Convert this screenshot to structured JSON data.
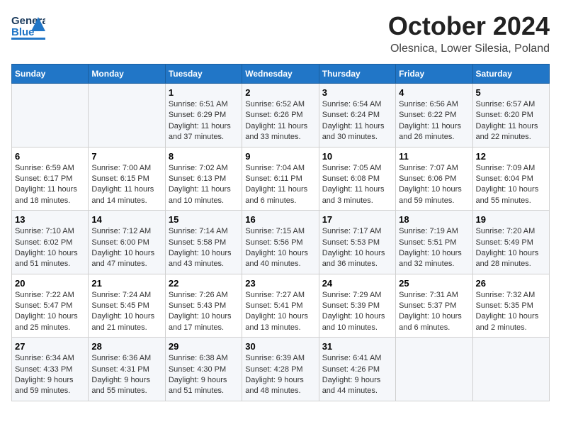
{
  "header": {
    "logo_general": "General",
    "logo_blue": "Blue",
    "month": "October 2024",
    "location": "Olesnica, Lower Silesia, Poland"
  },
  "days_of_week": [
    "Sunday",
    "Monday",
    "Tuesday",
    "Wednesday",
    "Thursday",
    "Friday",
    "Saturday"
  ],
  "weeks": [
    [
      {
        "day": "",
        "content": ""
      },
      {
        "day": "",
        "content": ""
      },
      {
        "day": "1",
        "content": "Sunrise: 6:51 AM\nSunset: 6:29 PM\nDaylight: 11 hours and 37 minutes."
      },
      {
        "day": "2",
        "content": "Sunrise: 6:52 AM\nSunset: 6:26 PM\nDaylight: 11 hours and 33 minutes."
      },
      {
        "day": "3",
        "content": "Sunrise: 6:54 AM\nSunset: 6:24 PM\nDaylight: 11 hours and 30 minutes."
      },
      {
        "day": "4",
        "content": "Sunrise: 6:56 AM\nSunset: 6:22 PM\nDaylight: 11 hours and 26 minutes."
      },
      {
        "day": "5",
        "content": "Sunrise: 6:57 AM\nSunset: 6:20 PM\nDaylight: 11 hours and 22 minutes."
      }
    ],
    [
      {
        "day": "6",
        "content": "Sunrise: 6:59 AM\nSunset: 6:17 PM\nDaylight: 11 hours and 18 minutes."
      },
      {
        "day": "7",
        "content": "Sunrise: 7:00 AM\nSunset: 6:15 PM\nDaylight: 11 hours and 14 minutes."
      },
      {
        "day": "8",
        "content": "Sunrise: 7:02 AM\nSunset: 6:13 PM\nDaylight: 11 hours and 10 minutes."
      },
      {
        "day": "9",
        "content": "Sunrise: 7:04 AM\nSunset: 6:11 PM\nDaylight: 11 hours and 6 minutes."
      },
      {
        "day": "10",
        "content": "Sunrise: 7:05 AM\nSunset: 6:08 PM\nDaylight: 11 hours and 3 minutes."
      },
      {
        "day": "11",
        "content": "Sunrise: 7:07 AM\nSunset: 6:06 PM\nDaylight: 10 hours and 59 minutes."
      },
      {
        "day": "12",
        "content": "Sunrise: 7:09 AM\nSunset: 6:04 PM\nDaylight: 10 hours and 55 minutes."
      }
    ],
    [
      {
        "day": "13",
        "content": "Sunrise: 7:10 AM\nSunset: 6:02 PM\nDaylight: 10 hours and 51 minutes."
      },
      {
        "day": "14",
        "content": "Sunrise: 7:12 AM\nSunset: 6:00 PM\nDaylight: 10 hours and 47 minutes."
      },
      {
        "day": "15",
        "content": "Sunrise: 7:14 AM\nSunset: 5:58 PM\nDaylight: 10 hours and 43 minutes."
      },
      {
        "day": "16",
        "content": "Sunrise: 7:15 AM\nSunset: 5:56 PM\nDaylight: 10 hours and 40 minutes."
      },
      {
        "day": "17",
        "content": "Sunrise: 7:17 AM\nSunset: 5:53 PM\nDaylight: 10 hours and 36 minutes."
      },
      {
        "day": "18",
        "content": "Sunrise: 7:19 AM\nSunset: 5:51 PM\nDaylight: 10 hours and 32 minutes."
      },
      {
        "day": "19",
        "content": "Sunrise: 7:20 AM\nSunset: 5:49 PM\nDaylight: 10 hours and 28 minutes."
      }
    ],
    [
      {
        "day": "20",
        "content": "Sunrise: 7:22 AM\nSunset: 5:47 PM\nDaylight: 10 hours and 25 minutes."
      },
      {
        "day": "21",
        "content": "Sunrise: 7:24 AM\nSunset: 5:45 PM\nDaylight: 10 hours and 21 minutes."
      },
      {
        "day": "22",
        "content": "Sunrise: 7:26 AM\nSunset: 5:43 PM\nDaylight: 10 hours and 17 minutes."
      },
      {
        "day": "23",
        "content": "Sunrise: 7:27 AM\nSunset: 5:41 PM\nDaylight: 10 hours and 13 minutes."
      },
      {
        "day": "24",
        "content": "Sunrise: 7:29 AM\nSunset: 5:39 PM\nDaylight: 10 hours and 10 minutes."
      },
      {
        "day": "25",
        "content": "Sunrise: 7:31 AM\nSunset: 5:37 PM\nDaylight: 10 hours and 6 minutes."
      },
      {
        "day": "26",
        "content": "Sunrise: 7:32 AM\nSunset: 5:35 PM\nDaylight: 10 hours and 2 minutes."
      }
    ],
    [
      {
        "day": "27",
        "content": "Sunrise: 6:34 AM\nSunset: 4:33 PM\nDaylight: 9 hours and 59 minutes."
      },
      {
        "day": "28",
        "content": "Sunrise: 6:36 AM\nSunset: 4:31 PM\nDaylight: 9 hours and 55 minutes."
      },
      {
        "day": "29",
        "content": "Sunrise: 6:38 AM\nSunset: 4:30 PM\nDaylight: 9 hours and 51 minutes."
      },
      {
        "day": "30",
        "content": "Sunrise: 6:39 AM\nSunset: 4:28 PM\nDaylight: 9 hours and 48 minutes."
      },
      {
        "day": "31",
        "content": "Sunrise: 6:41 AM\nSunset: 4:26 PM\nDaylight: 9 hours and 44 minutes."
      },
      {
        "day": "",
        "content": ""
      },
      {
        "day": "",
        "content": ""
      }
    ]
  ]
}
